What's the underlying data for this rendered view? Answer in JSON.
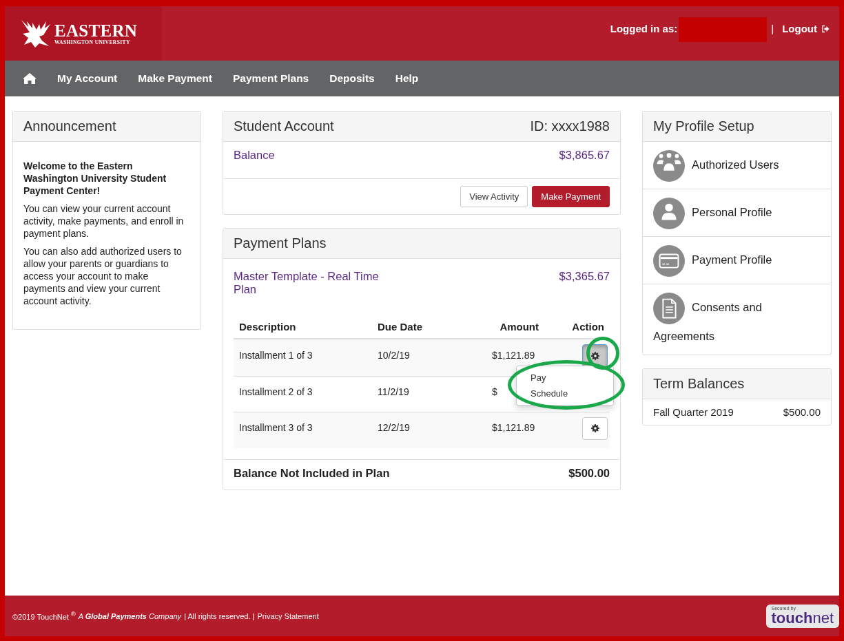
{
  "header": {
    "logo": {
      "name": "EASTERN",
      "subtitle": "WASHINGTON UNIVERSITY"
    },
    "logged_in_label": "Logged in as:",
    "user_redacted": true,
    "separator": "|",
    "logout": "Logout"
  },
  "nav": {
    "items": [
      "My Account",
      "Make Payment",
      "Payment Plans",
      "Deposits",
      "Help"
    ]
  },
  "announcement": {
    "title": "Announcement",
    "heading": "Welcome to the Eastern Washington University Student Payment Center!",
    "paragraphs": [
      "You can view your current account activity, make payments, and enroll in payment plans.",
      "You can also add authorized users to allow your parents or guardians to access your account to make payments and view your current account activity."
    ]
  },
  "student_account": {
    "title": "Student Account",
    "id": "ID: xxxx1988",
    "balance_label": "Balance",
    "balance": "$3,865.67",
    "buttons": [
      {
        "label": "View Activity",
        "kind": "default"
      },
      {
        "label": "Make Payment",
        "kind": "primary"
      }
    ]
  },
  "payment_plans": {
    "title": "Payment Plans",
    "plan_name": "Master Template - Real Time Plan",
    "plan_amount": "$3,365.67",
    "columns": [
      "Description",
      "Due Date",
      "Amount",
      "Action"
    ],
    "rows": [
      {
        "description": "Installment 1 of 3",
        "due_date": "10/2/19",
        "amount": "$1,121.89",
        "action": {
          "pressed": true,
          "highlighted": true
        },
        "menu": {
          "items": [
            "Pay",
            "Schedule"
          ],
          "highlighted": true
        }
      },
      {
        "description": "Installment 2 of 3",
        "due_date": "11/2/19",
        "amount": "$"
      },
      {
        "description": "Installment 3 of 3",
        "due_date": "12/2/19",
        "amount": "$1,121.89",
        "action": {
          "pressed": false
        }
      }
    ],
    "footer_label": "Balance Not Included in Plan",
    "footer_amount": "$500.00"
  },
  "profile_setup": {
    "title": "My Profile Setup",
    "items": [
      {
        "label": "Authorized Users",
        "kind": "users"
      },
      {
        "label": "Personal Profile",
        "kind": "person"
      },
      {
        "label": "Payment Profile",
        "kind": "card"
      },
      {
        "label": "Consents and Agreements",
        "kind": "document"
      }
    ]
  },
  "term_balances": {
    "title": "Term Balances",
    "rows": [
      {
        "term": "Fall Quarter 2019",
        "amount": "$500.00"
      }
    ]
  },
  "footer": {
    "copyright": "©2019 TouchNet $^{®}$",
    "company": "A **Global Payments** Company",
    "rights": "| All rights reserved. |",
    "privacy_link": "Privacy Statement",
    "badge": {
      "caption": "Secured by",
      "brand": "**touch**net"
    }
  }
}
